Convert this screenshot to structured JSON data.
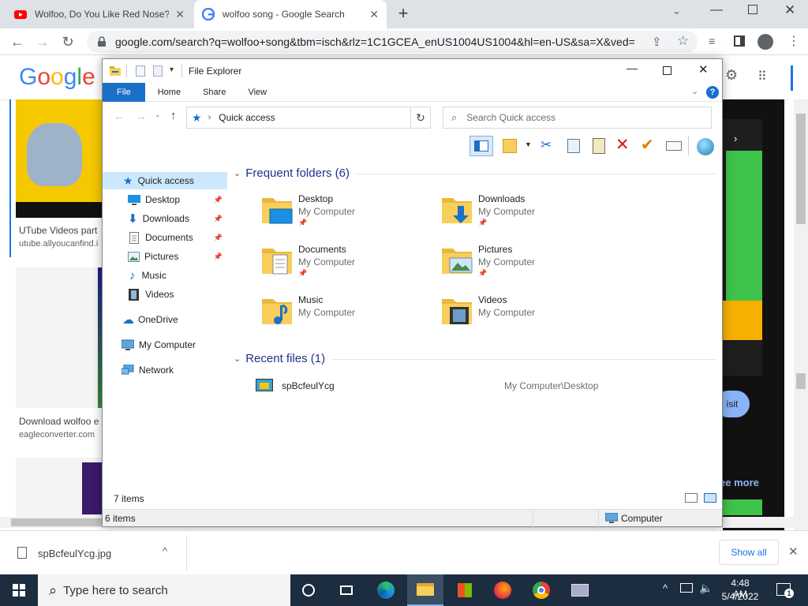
{
  "browser": {
    "tabs": [
      {
        "title": "Wolfoo, Do You Like Red Nose?",
        "active": false
      },
      {
        "title": "wolfoo song - Google Search",
        "active": true
      }
    ],
    "new_tab_label": "+",
    "url": "google.com/search?q=wolfoo+song&tbm=isch&rlz=1C1GCEA_enUS1004US1004&hl=en-US&sa=X&ved=...",
    "logo_text": "Google"
  },
  "page": {
    "results": [
      {
        "title": "UTube Videos part",
        "source": "utube.allyoucanfind.i"
      },
      {
        "title": "Download wolfoo e",
        "source": "eagleconverter.com"
      }
    ],
    "visit_label": "isit",
    "see_more_label": "ee more"
  },
  "explorer": {
    "title": "File Explorer",
    "ribbon_tabs": [
      "File",
      "Home",
      "Share",
      "View"
    ],
    "address": "Quick access",
    "search_placeholder": "Search Quick access",
    "nav": {
      "quick_access": "Quick access",
      "items": [
        {
          "label": "Desktop",
          "pinned": true
        },
        {
          "label": "Downloads",
          "pinned": true
        },
        {
          "label": "Documents",
          "pinned": true
        },
        {
          "label": "Pictures",
          "pinned": true
        },
        {
          "label": "Music",
          "pinned": false
        },
        {
          "label": "Videos",
          "pinned": false
        }
      ],
      "onedrive": "OneDrive",
      "my_computer": "My Computer",
      "network": "Network"
    },
    "frequent_header": "Frequent folders (6)",
    "folders": [
      {
        "name": "Desktop",
        "location": "My Computer",
        "pinned": true
      },
      {
        "name": "Downloads",
        "location": "My Computer",
        "pinned": true
      },
      {
        "name": "Documents",
        "location": "My Computer",
        "pinned": true
      },
      {
        "name": "Pictures",
        "location": "My Computer",
        "pinned": true
      },
      {
        "name": "Music",
        "location": "My Computer",
        "pinned": false
      },
      {
        "name": "Videos",
        "location": "My Computer",
        "pinned": false
      }
    ],
    "recent_header": "Recent files (1)",
    "recent_files": [
      {
        "name": "spBcfeulYcg",
        "path": "My Computer\\Desktop"
      }
    ],
    "items_count": "7 items",
    "status_items": "6 items",
    "status_location": "Computer"
  },
  "download": {
    "filename": "spBcfeulYcg.jpg",
    "show_all": "Show all"
  },
  "taskbar": {
    "search_placeholder": "Type here to search",
    "time": "4:48 AM",
    "date": "5/4/2022",
    "notification_count": "1"
  },
  "colors": {
    "accent": "#1a6fc9",
    "selection": "#cce8ff",
    "folder": "#f7cf5a",
    "taskbar": "#1c2d3f"
  }
}
